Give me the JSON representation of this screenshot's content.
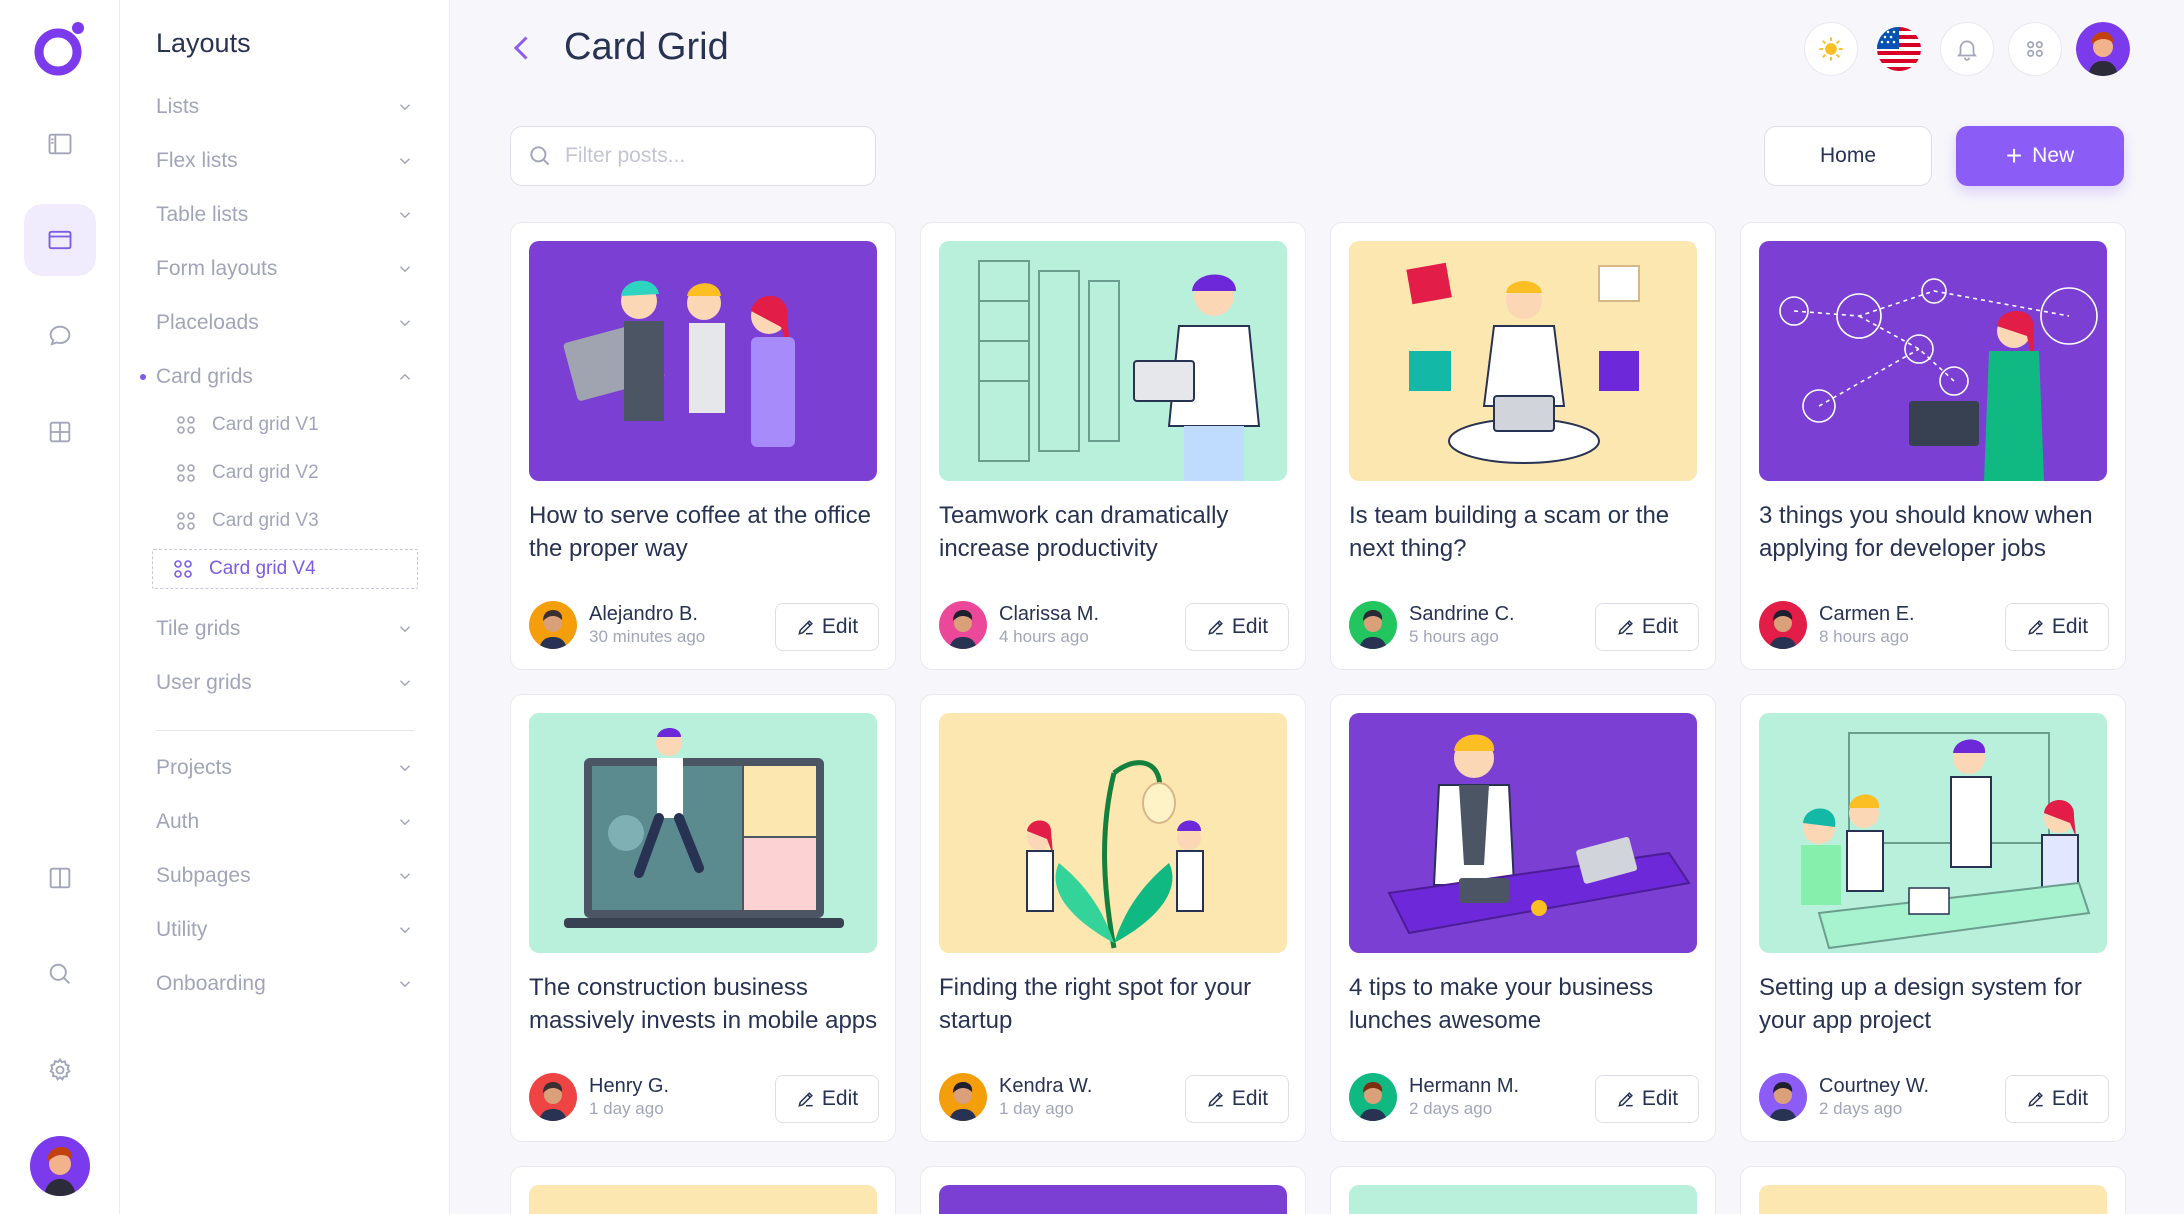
{
  "header": {
    "title": "Card Grid"
  },
  "subnav": {
    "title": "Layouts",
    "items": [
      {
        "label": "Lists"
      },
      {
        "label": "Flex lists"
      },
      {
        "label": "Table lists"
      },
      {
        "label": "Form layouts"
      },
      {
        "label": "Placeloads"
      },
      {
        "label": "Card grids",
        "expanded": true
      },
      {
        "label": "Tile grids"
      },
      {
        "label": "User grids"
      },
      {
        "label": "Projects"
      },
      {
        "label": "Auth"
      },
      {
        "label": "Subpages"
      },
      {
        "label": "Utility"
      },
      {
        "label": "Onboarding"
      }
    ],
    "card_grid_children": [
      {
        "label": "Card grid V1"
      },
      {
        "label": "Card grid V2"
      },
      {
        "label": "Card grid V3"
      },
      {
        "label": "Card grid V4",
        "active": true
      }
    ]
  },
  "toolbar": {
    "filter_placeholder": "Filter posts...",
    "home_label": "Home",
    "new_label": "New"
  },
  "colors": {
    "accent": "#8b5cf6",
    "purple_bg": "#7b3fd4",
    "mint_bg": "#b8f0dc",
    "cream_bg": "#fde7b0"
  },
  "cards": [
    {
      "title": "How to serve coffee at the office the proper way",
      "author": "Alejandro B.",
      "time": "30 minutes ago",
      "edit": "Edit",
      "bg": "purple"
    },
    {
      "title": "Teamwork can dramatically increase productivity",
      "author": "Clarissa M.",
      "time": "4 hours ago",
      "edit": "Edit",
      "bg": "mint"
    },
    {
      "title": "Is team building a scam or the next thing?",
      "author": "Sandrine C.",
      "time": "5 hours ago",
      "edit": "Edit",
      "bg": "cream"
    },
    {
      "title": "3 things you should know when applying for developer jobs",
      "author": "Carmen E.",
      "time": "8 hours ago",
      "edit": "Edit",
      "bg": "purple"
    },
    {
      "title": "The construction business massively invests in mobile apps",
      "author": "Henry G.",
      "time": "1 day ago",
      "edit": "Edit",
      "bg": "mint"
    },
    {
      "title": "Finding the right spot for your startup",
      "author": "Kendra W.",
      "time": "1 day ago",
      "edit": "Edit",
      "bg": "cream"
    },
    {
      "title": "4 tips to make your business lunches awesome",
      "author": "Hermann M.",
      "time": "2 days ago",
      "edit": "Edit",
      "bg": "purple"
    },
    {
      "title": "Setting up a design system for your app project",
      "author": "Courtney W.",
      "time": "2 days ago",
      "edit": "Edit",
      "bg": "mint"
    }
  ],
  "icons": {
    "rail": [
      "logo-icon",
      "sidebar-layout-icon",
      "window-icon",
      "chat-icon",
      "grid-icon",
      "columns-icon",
      "search-icon",
      "settings-icon"
    ],
    "top": [
      "sun-icon",
      "us-flag-icon",
      "bell-icon",
      "apps-grid-icon"
    ]
  }
}
